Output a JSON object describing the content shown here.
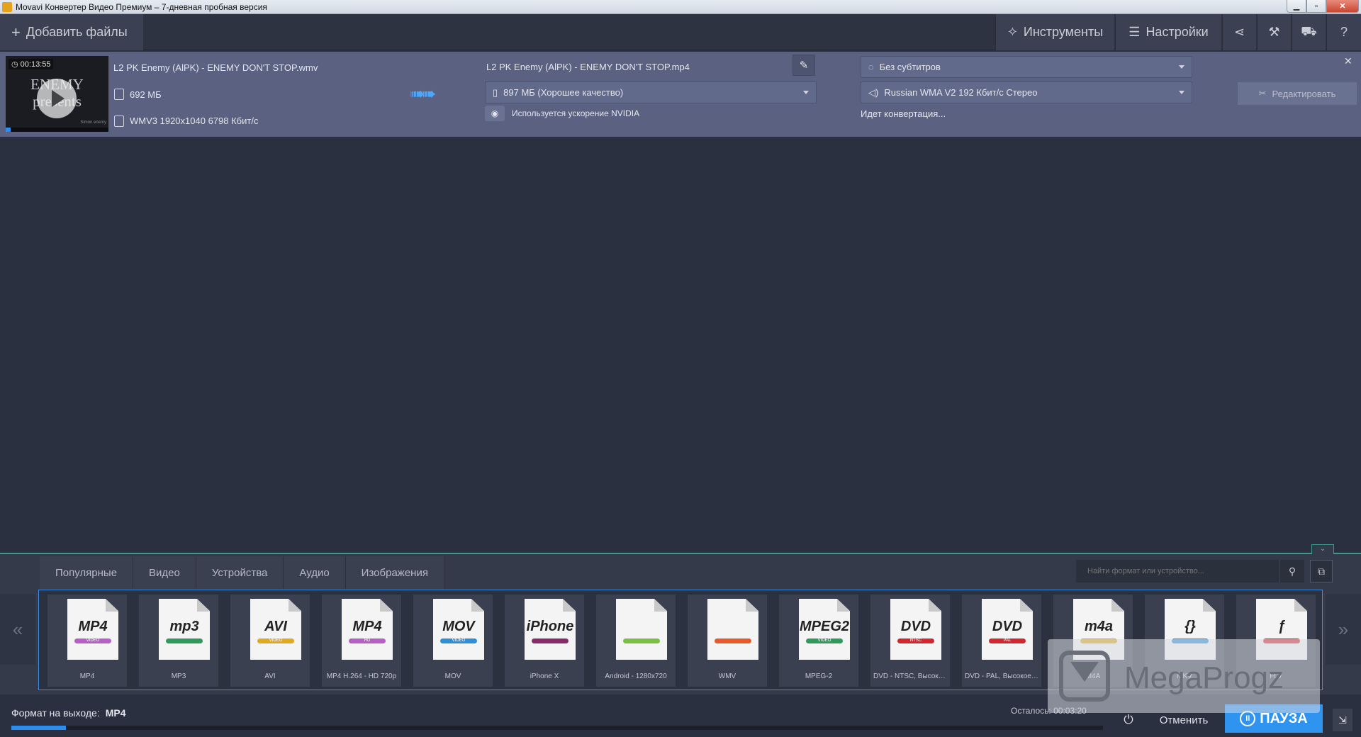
{
  "window": {
    "title": "Movavi Конвертер Видео Премиум – 7-дневная пробная версия",
    "min_glyph": "▁",
    "max_glyph": "▫",
    "close_glyph": "✕"
  },
  "toolbar": {
    "add_files_icon": "+",
    "add_files": "Добавить файлы",
    "tools_icon": "✧",
    "tools": "Инструменты",
    "settings_icon": "☰",
    "settings": "Настройки",
    "share_glyph": "⋖",
    "wrench_glyph": "⚒",
    "cart_glyph": "⛟",
    "help_glyph": "?"
  },
  "file": {
    "thumb_text": "ENEMY presents",
    "duration": "◷ 00:13:55",
    "credit": "Simon enemy",
    "progress_fraction": 0.05,
    "source_name": "L2 PK Enemy (AlPK) - ENEMY DON'T STOP.wmv",
    "source_size": "692 МБ",
    "source_info": "WMV3 1920x1040 6798 Кбит/с",
    "arrow_glyph": "➠➠",
    "output_name": "L2 PK Enemy (AlPK) - ENEMY DON'T STOP.mp4",
    "edit_name_glyph": "✎",
    "output_size": "897 МБ (Хорошее качество)",
    "nvidia_glyph": "◉",
    "acceleration": "Используется ускорение NVIDIA",
    "subtitles_icon": "◌",
    "subtitles": "Без субтитров",
    "audio_icon": "◁)",
    "audio": "Russian WMA V2 192 Кбит/с Стерео",
    "status": "Идет конвертация...",
    "edit_icon": "✂",
    "edit_button": "Редактировать",
    "close_glyph": "✕"
  },
  "panel": {
    "collapse_glyph": "⌄",
    "tabs": [
      "Популярные",
      "Видео",
      "Устройства",
      "Аудио",
      "Изображения"
    ],
    "search_placeholder": "Найти формат или устройство...",
    "search_glyph": "⚲",
    "search_device_glyph": "⧉",
    "scroll_left": "«",
    "scroll_right": "»",
    "formats": [
      {
        "logo": "MP4",
        "sub": "VIDEO",
        "label": "MP4",
        "color": "#b55fc7"
      },
      {
        "logo": "mp3",
        "sub": "",
        "label": "MP3",
        "color": "#2f9a5a"
      },
      {
        "logo": "AVI",
        "sub": "VIDEO",
        "label": "AVI",
        "color": "#e0a91e"
      },
      {
        "logo": "MP4",
        "sub": "HD",
        "label": "MP4 H.264 - HD 720p",
        "color": "#b55fc7"
      },
      {
        "logo": "MOV",
        "sub": "VIDEO",
        "label": "MOV",
        "color": "#2f8fd8"
      },
      {
        "logo": "iPhone",
        "sub": "",
        "label": "iPhone X",
        "color": "#8a2a6a"
      },
      {
        "logo": "",
        "sub": "",
        "label": "Android - 1280x720",
        "color": "#7cc043"
      },
      {
        "logo": "",
        "sub": "",
        "label": "WMV",
        "color": "#e85a2a"
      },
      {
        "logo": "MPEG2",
        "sub": "VIDEO",
        "label": "MPEG-2",
        "color": "#2f9a5a"
      },
      {
        "logo": "DVD",
        "sub": "NTSC",
        "label": "DVD - NTSC, Высокое качество",
        "color": "#d3262e"
      },
      {
        "logo": "DVD",
        "sub": "PAL",
        "label": "DVD - PAL, Высокое качество",
        "color": "#d3262e"
      },
      {
        "logo": "m4a",
        "sub": "",
        "label": "M4A",
        "color": "#e0a91e"
      },
      {
        "logo": "{}",
        "sub": "",
        "label": "MKV",
        "color": "#2f8fd8"
      },
      {
        "logo": "ƒ",
        "sub": "",
        "label": "FLV",
        "color": "#d3262e"
      }
    ]
  },
  "footer": {
    "output_format_label": "Формат на выходе:",
    "output_format_value": "MP4",
    "remaining": "Осталось: 00:03:20",
    "power_glyph": "⏻",
    "cancel": "Отменить",
    "pause_icon": "II",
    "pause": "ПАУЗА",
    "corner_glyph": "⇲",
    "progress_fraction": 0.05
  },
  "watermark": {
    "text": "MegaProgz"
  }
}
